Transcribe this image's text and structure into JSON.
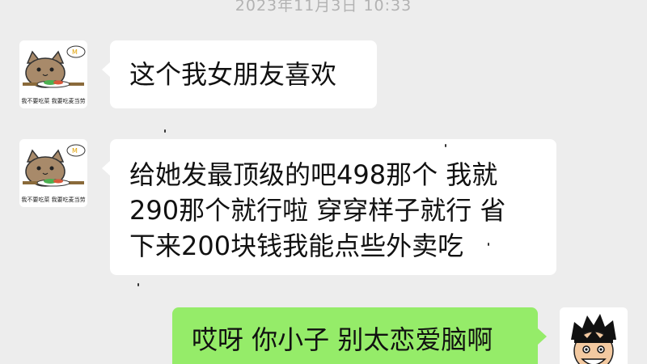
{
  "chat": {
    "timestamp": "2023年11月3日 10:33",
    "messages": [
      {
        "sender": "friend",
        "avatar": "cat-avatar",
        "avatar_caption": "我不要吃菜 我要吃麦当劳",
        "lines": [
          "这个我女朋友喜欢"
        ]
      },
      {
        "sender": "friend",
        "avatar": "cat-avatar",
        "avatar_caption": "我不要吃菜 我要吃麦当劳",
        "lines": [
          "给她发最顶级的吧498那个 我就",
          "290那个就行啦 穿穿样子就行 省",
          "下来200块钱我能点些外卖吃"
        ]
      },
      {
        "sender": "me",
        "avatar": "luffy-avatar",
        "lines": [
          "哎呀 你小子 别太恋爱脑啊"
        ]
      }
    ]
  },
  "colors": {
    "background": "#ededed",
    "incoming_bubble": "#ffffff",
    "outgoing_bubble": "#95ec69",
    "timestamp_text": "#b2b2b2"
  }
}
